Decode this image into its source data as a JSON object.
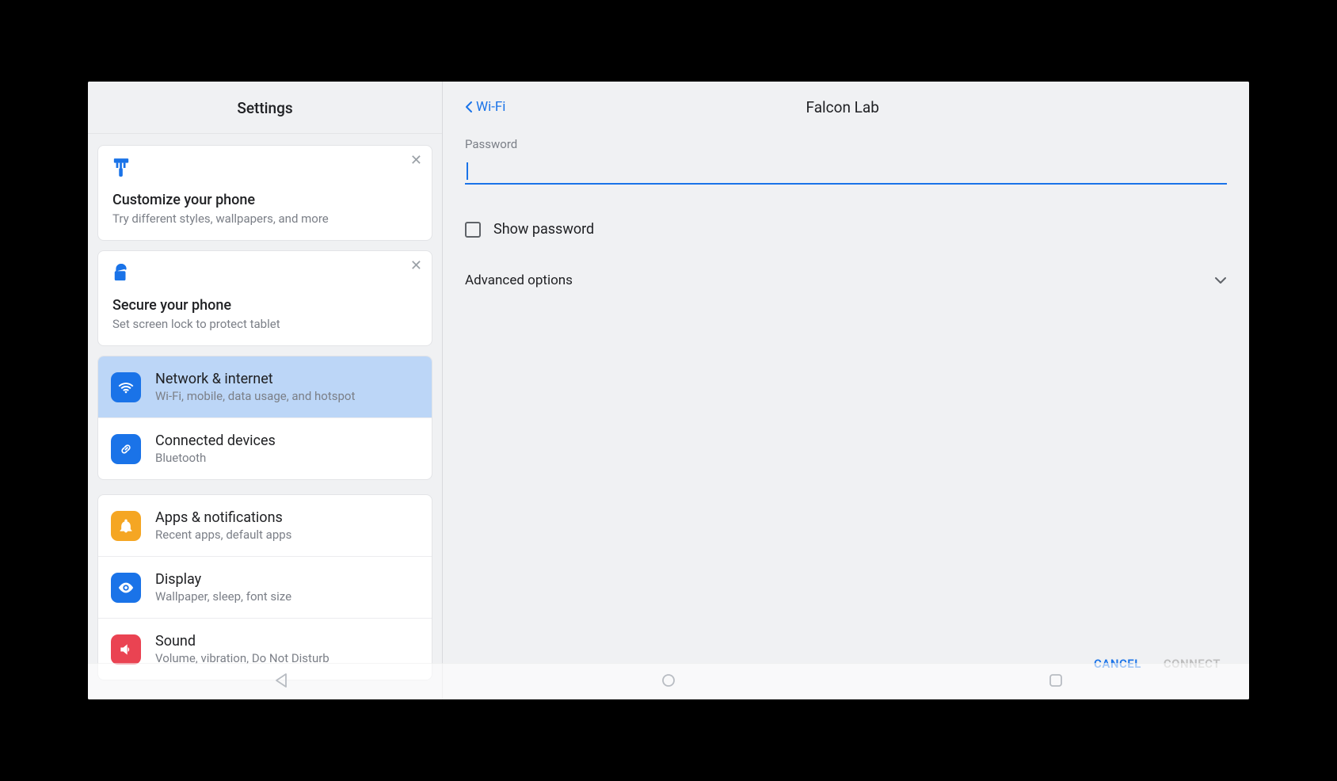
{
  "sidebar": {
    "title": "Settings",
    "cards": [
      {
        "title": "Customize your phone",
        "subtitle": "Try different styles, wallpapers, and more",
        "icon": "brush-icon"
      },
      {
        "title": "Secure your phone",
        "subtitle": "Set screen lock to protect tablet",
        "icon": "unlock-icon"
      }
    ],
    "group1": [
      {
        "title": "Network & internet",
        "subtitle": "Wi-Fi, mobile, data usage, and hotspot",
        "icon": "wifi-icon",
        "bg": "ic-blue",
        "active": true
      },
      {
        "title": "Connected devices",
        "subtitle": "Bluetooth",
        "icon": "link-icon",
        "bg": "ic-blue",
        "active": false
      }
    ],
    "group2": [
      {
        "title": "Apps & notifications",
        "subtitle": "Recent apps, default apps",
        "icon": "bell-icon",
        "bg": "ic-orange"
      },
      {
        "title": "Display",
        "subtitle": "Wallpaper, sleep, font size",
        "icon": "eye-icon",
        "bg": "ic-blue"
      },
      {
        "title": "Sound",
        "subtitle": "Volume, vibration, Do Not Disturb",
        "icon": "speaker-icon",
        "bg": "ic-red"
      }
    ]
  },
  "main": {
    "back_label": "Wi-Fi",
    "network_name": "Falcon Lab",
    "password_label": "Password",
    "password_value": "",
    "show_password_label": "Show password",
    "advanced_label": "Advanced options",
    "cancel_label": "CANCEL",
    "connect_label": "CONNECT"
  }
}
